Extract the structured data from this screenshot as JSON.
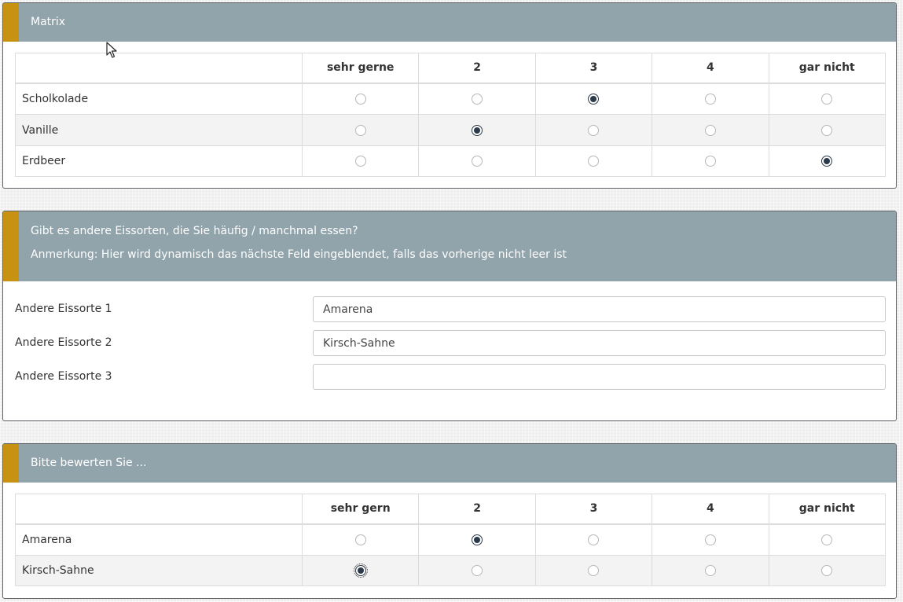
{
  "matrix1": {
    "title": "Matrix",
    "columns": [
      "sehr gerne",
      "2",
      "3",
      "4",
      "gar nicht"
    ],
    "rows": [
      {
        "label": "Scholkolade",
        "selected": 2
      },
      {
        "label": "Vanille",
        "selected": 1
      },
      {
        "label": "Erdbeer",
        "selected": 4
      }
    ]
  },
  "other": {
    "title": "Gibt es andere Eissorten, die Sie häufig / manchmal essen?",
    "note": "Anmerkung: Hier wird dynamisch das nächste Feld eingeblendet, falls das vorherige nicht leer ist",
    "fields": [
      {
        "label": "Andere Eissorte 1",
        "value": "Amarena"
      },
      {
        "label": "Andere Eissorte 2",
        "value": "Kirsch-Sahne"
      },
      {
        "label": "Andere Eissorte 3",
        "value": ""
      }
    ]
  },
  "matrix2": {
    "title": "Bitte bewerten Sie ...",
    "columns": [
      "sehr gern",
      "2",
      "3",
      "4",
      "gar nicht"
    ],
    "rows": [
      {
        "label": "Amarena",
        "selected": 1
      },
      {
        "label": "Kirsch-Sahne",
        "selected": 0
      }
    ]
  },
  "colors": {
    "header": "#91a3ab",
    "accent": "#c79212",
    "radio_checked": "#2b3a4a"
  }
}
